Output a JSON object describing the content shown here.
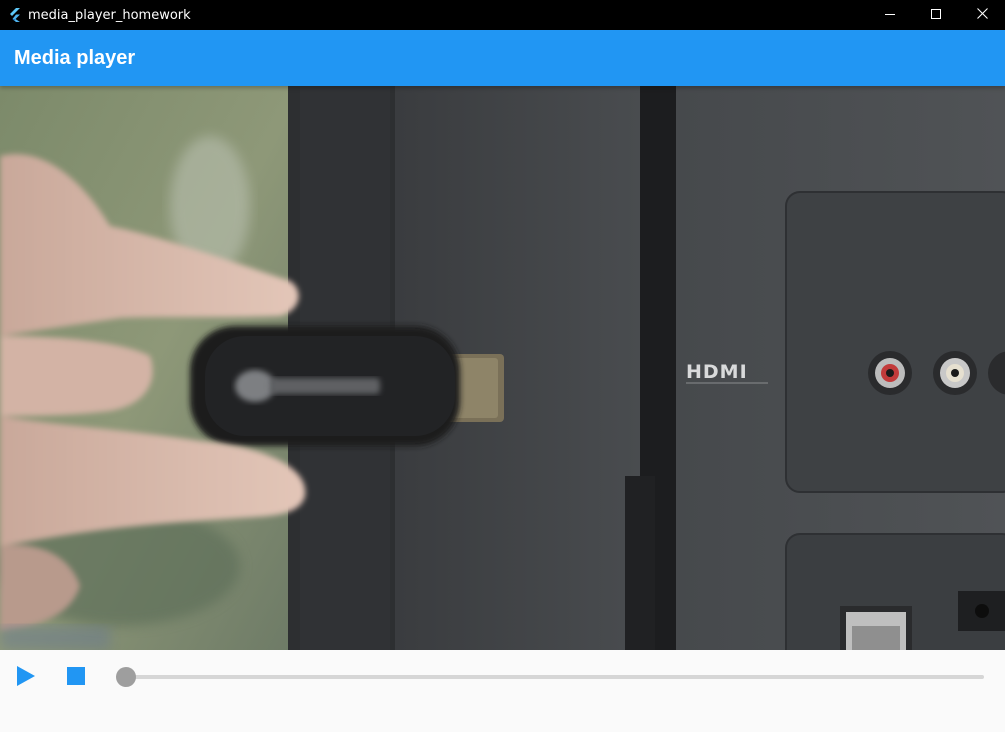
{
  "window": {
    "title": "media_player_homework",
    "icons": {
      "app": "flutter-logo-icon",
      "minimize": "minimize-icon",
      "maximize": "maximize-icon",
      "close": "close-icon"
    }
  },
  "appbar": {
    "title": "Media player",
    "color": "#2196f3"
  },
  "video": {
    "frame_text": "HDMI"
  },
  "controls": {
    "play_icon": "play-icon",
    "stop_icon": "stop-icon",
    "accent_color": "#2196f3",
    "progress": 0
  }
}
